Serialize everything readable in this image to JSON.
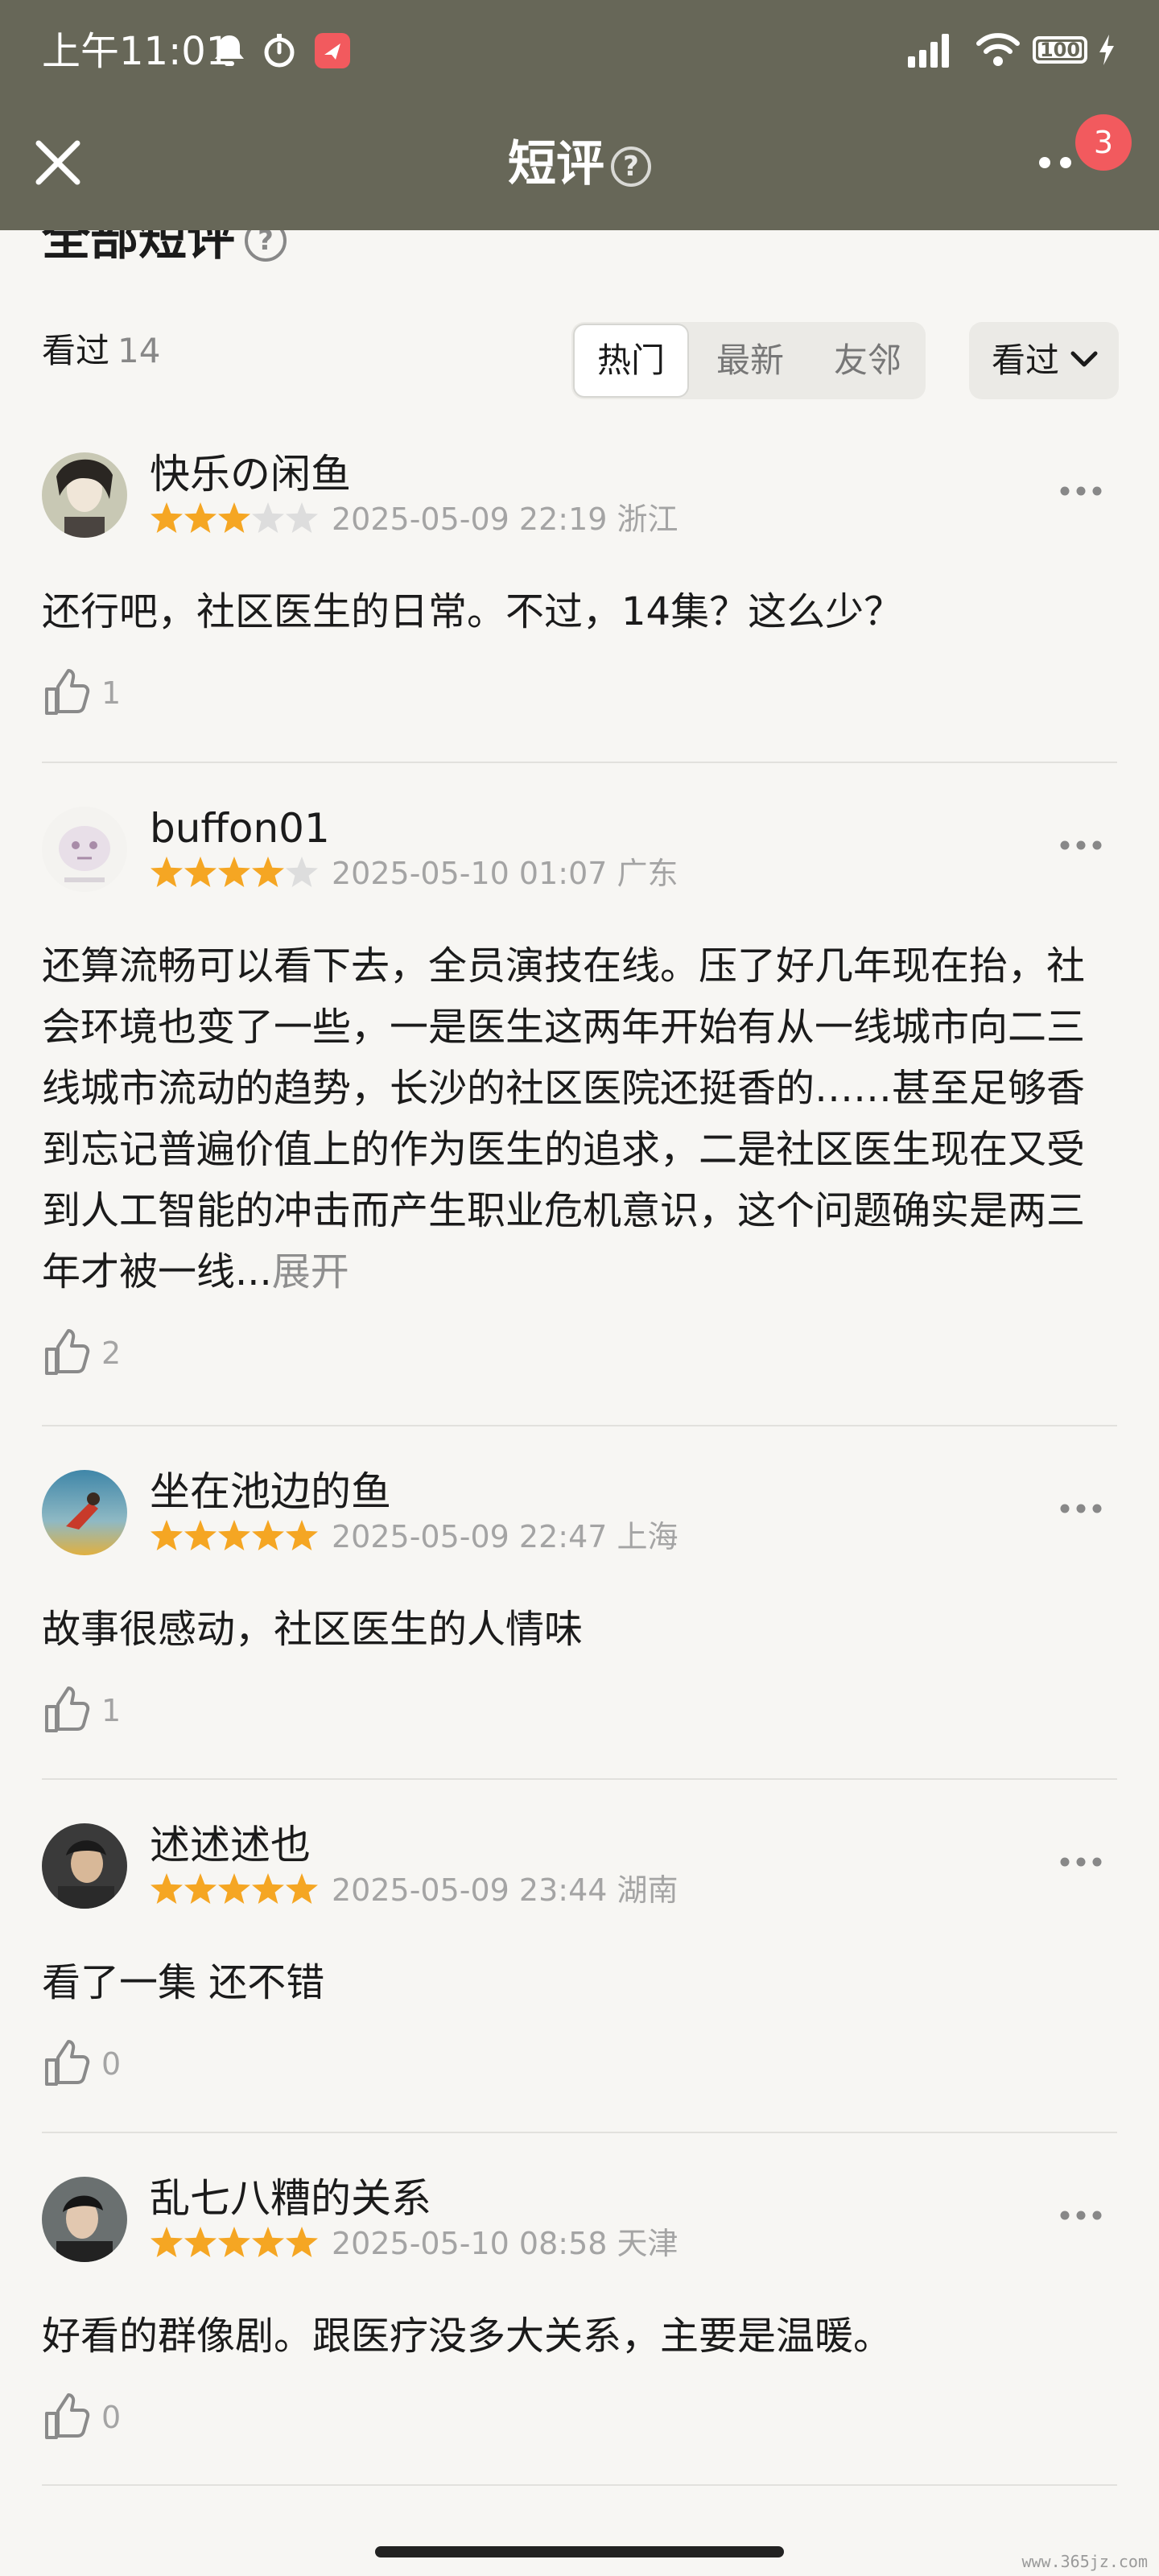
{
  "status_bar": {
    "time": "上午11:01",
    "battery": "100"
  },
  "header": {
    "title": "短评",
    "help_symbol": "?",
    "notification_count": "3"
  },
  "section": {
    "title": "全部短评",
    "help_symbol": "?"
  },
  "filters": {
    "seen_label": "看过",
    "seen_count": "14",
    "tabs": [
      {
        "label": "热门"
      },
      {
        "label": "最新"
      },
      {
        "label": "友邻"
      }
    ],
    "active_tab": "热门",
    "dropdown_label": "看过"
  },
  "colors": {
    "header_bg": "#676758",
    "star_on": "#f5a623",
    "star_off": "#dddddd",
    "badge": "#f25a5e"
  },
  "reviews": [
    {
      "user": "快乐の闲鱼",
      "rating": 3,
      "timestamp": "2025-05-09 22:19 浙江",
      "text": "还行吧，社区医生的日常。不过，14集？这么少？",
      "likes": "1"
    },
    {
      "user": "buffon01",
      "rating": 4,
      "timestamp": "2025-05-10 01:07 广东",
      "text": "还算流畅可以看下去，全员演技在线。压了好几年现在抬，社会环境也变了一些，一是医生这两年开始有从一线城市向二三线城市流动的趋势，长沙的社区医院还挺香的……甚至足够香到忘记普遍价值上的作为医生的追求，二是社区医生现在又受到人工智能的冲击而产生职业危机意识，这个问题确实是两三年才被一线...",
      "expand": "展开",
      "likes": "2"
    },
    {
      "user": "坐在池边的鱼",
      "rating": 5,
      "timestamp": "2025-05-09 22:47 上海",
      "text": "故事很感动，社区医生的人情味",
      "likes": "1"
    },
    {
      "user": "述述述也",
      "rating": 5,
      "timestamp": "2025-05-09 23:44 湖南",
      "text": "看了一集 还不错",
      "likes": "0"
    },
    {
      "user": "乱七八糟的关系",
      "rating": 5,
      "timestamp": "2025-05-10 08:58 天津",
      "text": "好看的群像剧。跟医疗没多大关系，主要是温暖。",
      "likes": "0"
    }
  ],
  "watermark": "www.365jz.com"
}
